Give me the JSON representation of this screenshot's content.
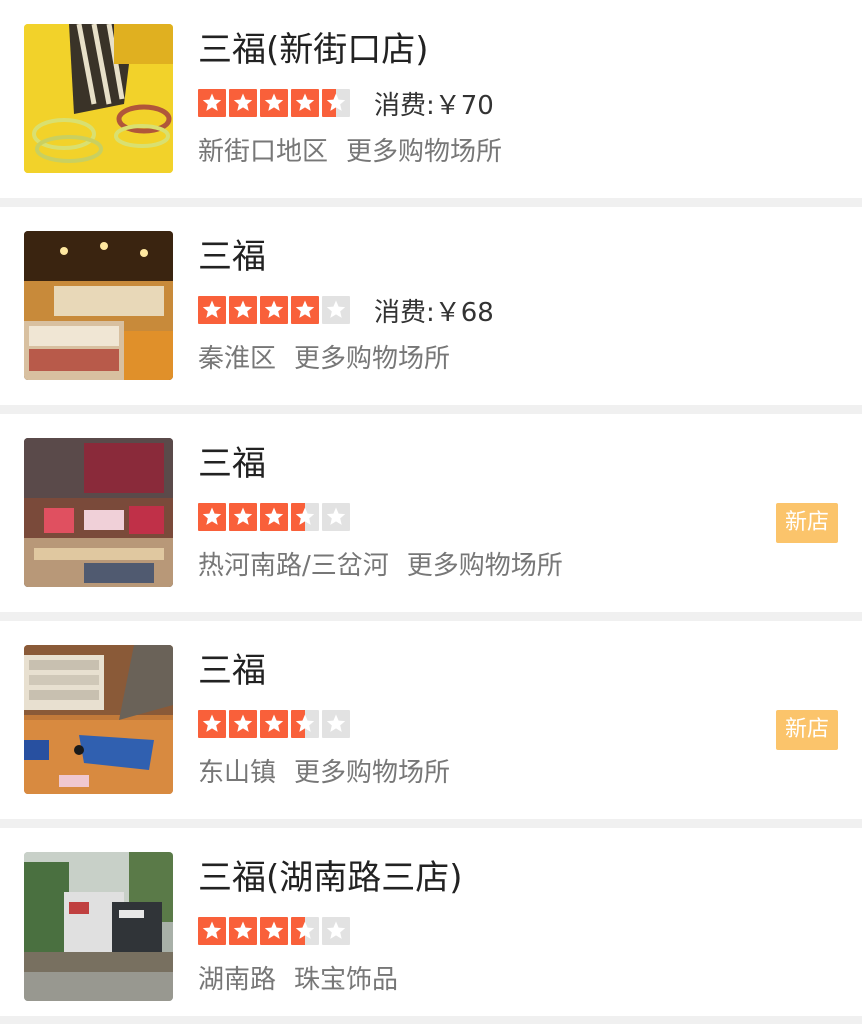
{
  "colors": {
    "star_on": "#f9603a",
    "star_off": "#e2e2e2",
    "badge": "#fbc46b"
  },
  "shops": [
    {
      "name": "三福(新街口店)",
      "rating": 4.5,
      "price": "消费:￥70",
      "area": "新街口地区",
      "category": "更多购物场所",
      "badge": ""
    },
    {
      "name": "三福",
      "rating": 4,
      "price": "消费:￥68",
      "area": "秦淮区",
      "category": "更多购物场所",
      "badge": ""
    },
    {
      "name": "三福",
      "rating": 3.5,
      "price": "",
      "area": "热河南路/三岔河",
      "category": "更多购物场所",
      "badge": "新店"
    },
    {
      "name": "三福",
      "rating": 3.5,
      "price": "",
      "area": "东山镇",
      "category": "更多购物场所",
      "badge": "新店"
    },
    {
      "name": "三福(湖南路三店)",
      "rating": 3.5,
      "price": "",
      "area": "湖南路",
      "category": "珠宝饰品",
      "badge": ""
    }
  ]
}
